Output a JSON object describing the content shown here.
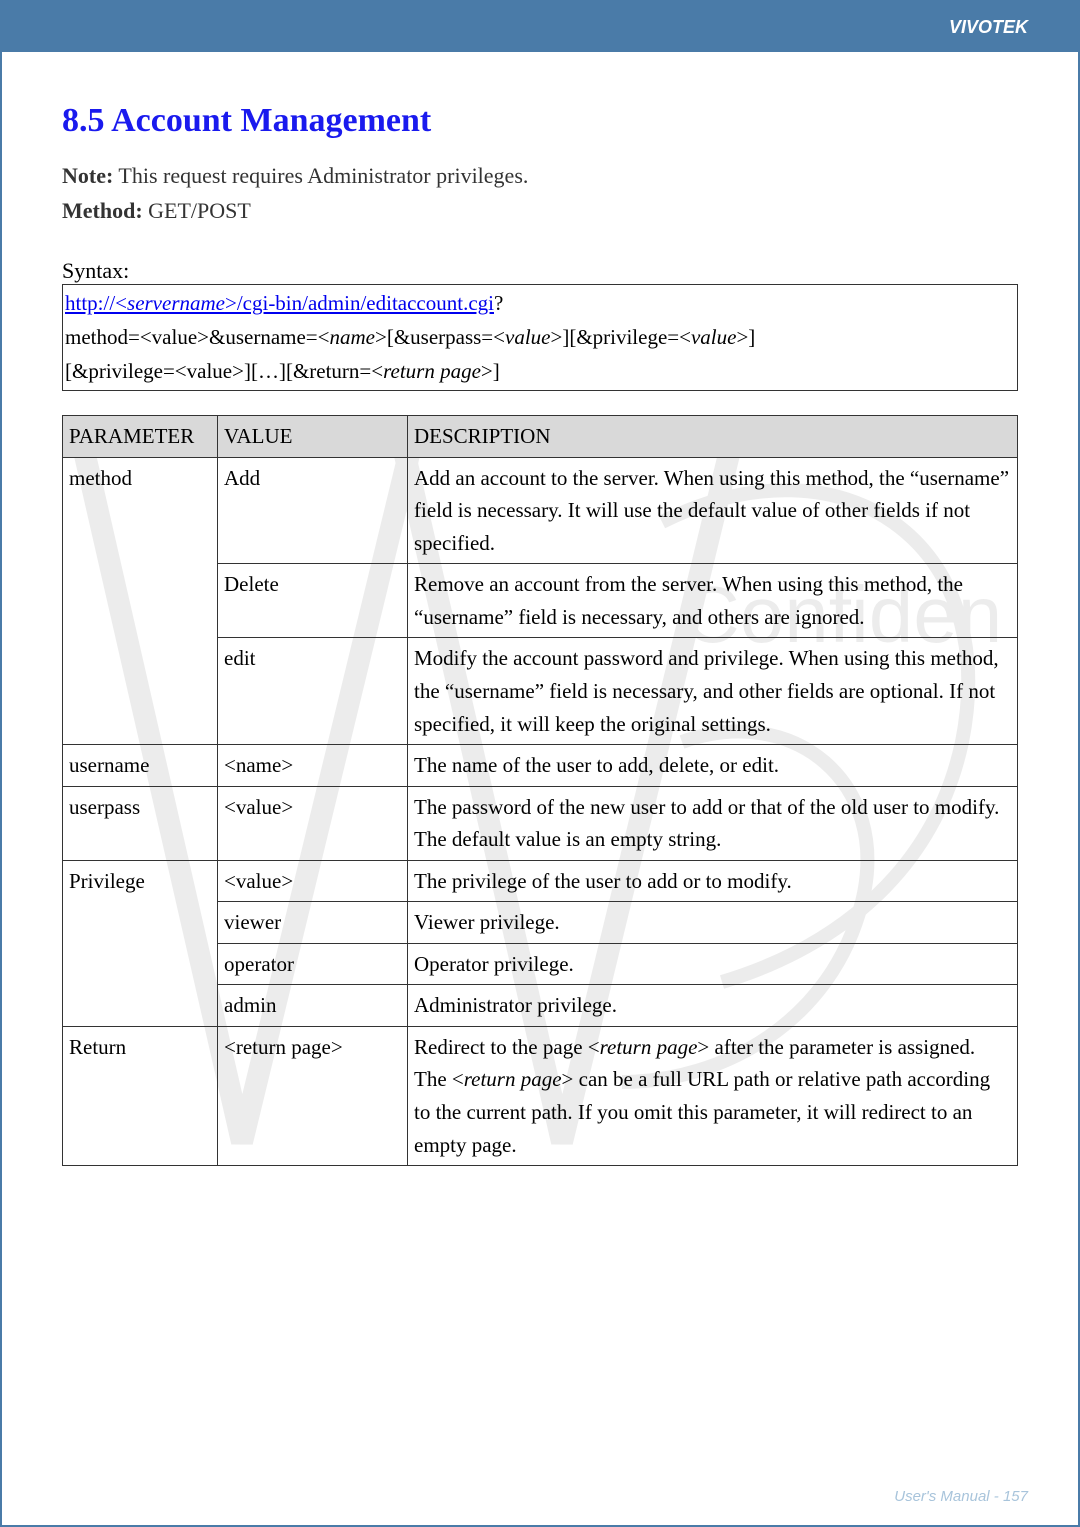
{
  "brand": "VIVOTEK",
  "heading": "8.5 Account Management",
  "note_label": "Note:",
  "note_text": " This request requires Administrator privileges.",
  "method_label": "Method:",
  "method_text": " GET/POST",
  "syntax_label": "Syntax:",
  "syntax": {
    "line1_link_pre": "http://<",
    "line1_link_server": "servername",
    "line1_link_post": ">/cgi-bin/admin/editaccount.cgi",
    "line1_tail": "?",
    "line2_a": "method=<value>&username=<",
    "line2_name": "name",
    "line2_b": ">[&userpass=<",
    "line2_val1": "value",
    "line2_c": ">][&privilege=<",
    "line2_val2": "value",
    "line2_d": ">]",
    "line3_a": "[&privilege=<value>][…][&return=<",
    "line3_ret": "return page",
    "line3_b": ">]"
  },
  "table": {
    "headers": [
      "PARAMETER",
      "VALUE",
      "DESCRIPTION"
    ],
    "rows": [
      {
        "param": "method",
        "value": "Add",
        "desc": "Add an account to the server. When using this method, the “username” field is necessary. It will use the default value of other fields if not specified.",
        "param_rowspan": 3
      },
      {
        "value": "Delete",
        "desc": "Remove an account from the server. When using this method, the “username” field is necessary, and others are ignored."
      },
      {
        "value": "edit",
        "desc": "Modify the account password and privilege. When using this method, the “username” field is necessary, and other fields are optional. If not specified, it will keep the original settings."
      },
      {
        "param": "username",
        "value": "<name>",
        "desc": "The name of the user to add, delete, or edit."
      },
      {
        "param": "userpass",
        "value": "<value>",
        "desc": "The password of the new user to add or that of the old user to modify. The default value is an empty string."
      },
      {
        "param": "Privilege",
        "value": "<value>",
        "desc": "The privilege of the user to add or to modify.",
        "param_rowspan": 4
      },
      {
        "value": "viewer",
        "desc": "Viewer privilege."
      },
      {
        "value": "operator",
        "desc": "Operator privilege."
      },
      {
        "value": "admin",
        "desc": "Administrator privilege."
      },
      {
        "param": "Return",
        "value": "<return page>",
        "desc_html": true,
        "desc_parts": {
          "a": "Redirect to the page <",
          "b": "return page",
          "c": "> after the parameter is assigned. The <",
          "d": "return page",
          "e": "> can be a full URL path or relative path according to the current path. If you omit this parameter, it will redirect to an empty page."
        }
      }
    ]
  },
  "footer": "User's Manual - 157"
}
